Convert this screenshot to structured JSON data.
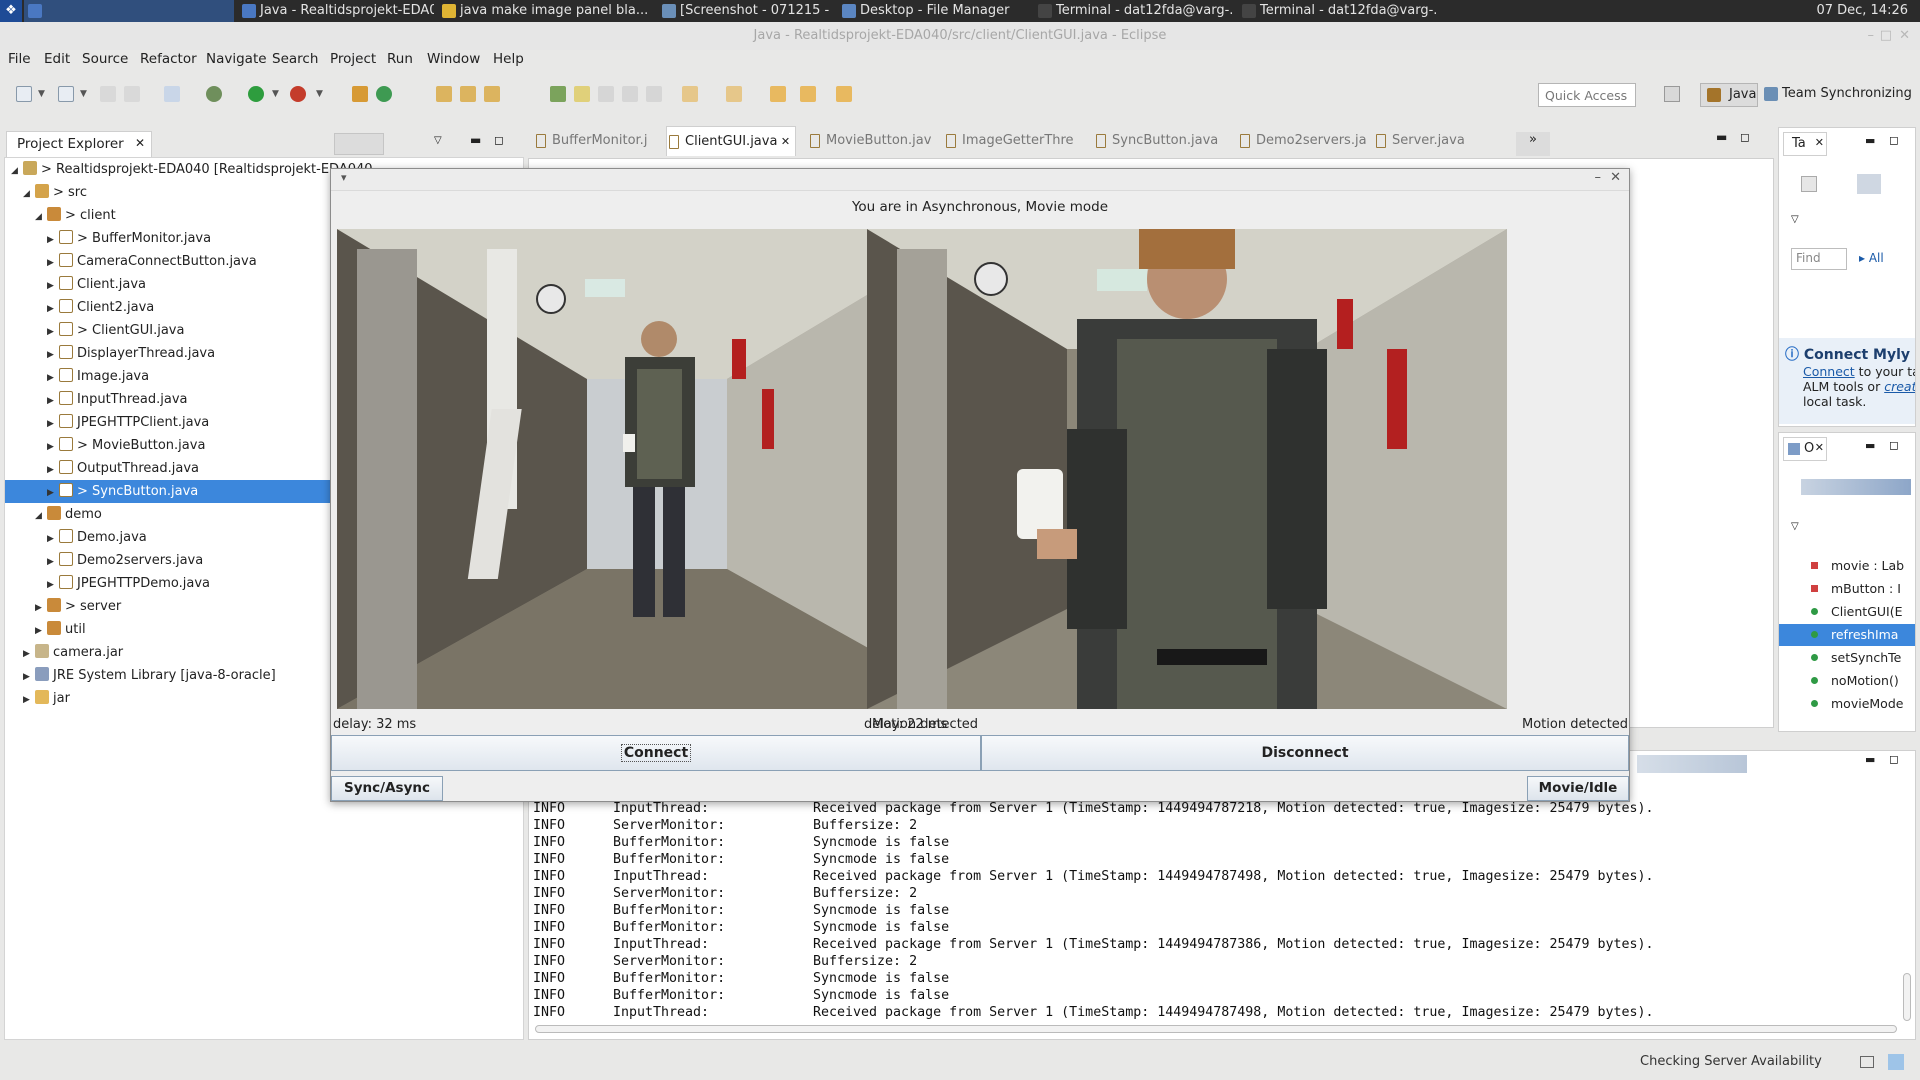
{
  "taskbar": {
    "tasks": [
      {
        "label": "",
        "active": true
      },
      {
        "label": "Java - Realtidsprojekt-EDA0..."
      },
      {
        "label": "java make image panel bla..."
      },
      {
        "label": "[Screenshot - 071215 - 13:1..."
      },
      {
        "label": "Desktop - File Manager"
      },
      {
        "label": "Terminal - dat12fda@varg-..."
      },
      {
        "label": "Terminal - dat12fda@varg-..."
      }
    ],
    "clock": "07 Dec, 14:26"
  },
  "window_title": "Java - Realtidsprojekt-EDA040/src/client/ClientGUI.java - Eclipse",
  "menu": [
    "File",
    "Edit",
    "Source",
    "Refactor",
    "Navigate",
    "Search",
    "Project",
    "Run",
    "Window",
    "Help"
  ],
  "quick_access": {
    "placeholder": "Quick Access"
  },
  "perspectives": {
    "java": "Java",
    "team": "Team Synchronizing"
  },
  "project_explorer": {
    "title": "Project Explorer",
    "tree": [
      {
        "label": "> Realtidsprojekt-EDA040  [Realtidsprojekt-EDA040",
        "depth": 0,
        "expanded": true,
        "icon": "project-icon"
      },
      {
        "label": "> src",
        "depth": 1,
        "expanded": true,
        "icon": "package-folder-icon"
      },
      {
        "label": "> client",
        "depth": 2,
        "expanded": true,
        "icon": "package-icon"
      },
      {
        "label": "> BufferMonitor.java",
        "depth": 3,
        "icon": "java-file-icon"
      },
      {
        "label": "CameraConnectButton.java",
        "depth": 3,
        "icon": "java-file-icon"
      },
      {
        "label": "Client.java",
        "depth": 3,
        "icon": "java-file-icon"
      },
      {
        "label": "Client2.java",
        "depth": 3,
        "icon": "java-file-icon"
      },
      {
        "label": "> ClientGUI.java",
        "depth": 3,
        "icon": "java-file-icon"
      },
      {
        "label": "DisplayerThread.java",
        "depth": 3,
        "icon": "java-file-icon"
      },
      {
        "label": "Image.java",
        "depth": 3,
        "icon": "java-file-icon"
      },
      {
        "label": "InputThread.java",
        "depth": 3,
        "icon": "java-file-icon"
      },
      {
        "label": "JPEGHTTPClient.java",
        "depth": 3,
        "icon": "java-file-icon"
      },
      {
        "label": "> MovieButton.java",
        "depth": 3,
        "icon": "java-file-icon"
      },
      {
        "label": "OutputThread.java",
        "depth": 3,
        "icon": "java-file-icon"
      },
      {
        "label": "> SyncButton.java",
        "depth": 3,
        "icon": "java-file-icon",
        "selected": true
      },
      {
        "label": "demo",
        "depth": 2,
        "expanded": true,
        "icon": "package-icon"
      },
      {
        "label": "Demo.java",
        "depth": 3,
        "icon": "java-file-icon"
      },
      {
        "label": "Demo2servers.java",
        "depth": 3,
        "icon": "java-file-icon"
      },
      {
        "label": "JPEGHTTPDemo.java",
        "depth": 3,
        "icon": "java-file-icon"
      },
      {
        "label": "> server",
        "depth": 2,
        "icon": "package-icon"
      },
      {
        "label": "util",
        "depth": 2,
        "icon": "package-icon"
      },
      {
        "label": "camera.jar",
        "depth": 1,
        "icon": "jar-icon"
      },
      {
        "label": "JRE System Library [java-8-oracle]",
        "depth": 1,
        "icon": "library-icon"
      },
      {
        "label": "jar",
        "depth": 1,
        "icon": "folder-icon"
      }
    ]
  },
  "editor_tabs": [
    {
      "label": "BufferMonitor.j"
    },
    {
      "label": "ClientGUI.java",
      "active": true
    },
    {
      "label": "MovieButton.jav"
    },
    {
      "label": "ImageGetterThre"
    },
    {
      "label": "SyncButton.java"
    },
    {
      "label": "Demo2servers.ja"
    },
    {
      "label": "Server.java"
    }
  ],
  "task_list": {
    "tab": "Ta",
    "find_placeholder": "Find",
    "all_label": "All",
    "connect_title": "Connect Myly",
    "connect_link": "Connect",
    "connect_text": "to your ta",
    "alm_text": "ALM tools or",
    "create_link": "creat",
    "local_task": "local task."
  },
  "outline": {
    "tab": "O",
    "items": [
      {
        "label": "movie : Lab",
        "kind": "field-private"
      },
      {
        "label": "mButton : I",
        "kind": "field-private"
      },
      {
        "label": "ClientGUI(E",
        "kind": "constructor"
      },
      {
        "label": "refreshIma",
        "kind": "method",
        "selected": true
      },
      {
        "label": "setSynchTe",
        "kind": "method"
      },
      {
        "label": "noMotion()",
        "kind": "method"
      },
      {
        "label": "movieMode",
        "kind": "method"
      }
    ]
  },
  "console": {
    "lines": [
      [
        "INFO",
        "InputThread:",
        "Received package from Server 1 (TimeStamp: 1449494787218, Motion detected: true, Imagesize: 25479 bytes)."
      ],
      [
        "INFO",
        "ServerMonitor:",
        "Buffersize: 2"
      ],
      [
        "INFO",
        "BufferMonitor:",
        "Syncmode is false"
      ],
      [
        "INFO",
        "BufferMonitor:",
        "Syncmode is false"
      ],
      [
        "INFO",
        "InputThread:",
        "Received package from Server 1 (TimeStamp: 1449494787498, Motion detected: true, Imagesize: 25479 bytes)."
      ],
      [
        "INFO",
        "ServerMonitor:",
        "Buffersize: 2"
      ],
      [
        "INFO",
        "BufferMonitor:",
        "Syncmode is false"
      ],
      [
        "INFO",
        "BufferMonitor:",
        "Syncmode is false"
      ],
      [
        "INFO",
        "InputThread:",
        "Received package from Server 1 (TimeStamp: 1449494787386, Motion detected: true, Imagesize: 25479 bytes)."
      ],
      [
        "INFO",
        "ServerMonitor:",
        "Buffersize: 2"
      ],
      [
        "INFO",
        "BufferMonitor:",
        "Syncmode is false"
      ],
      [
        "INFO",
        "BufferMonitor:",
        "Syncmode is false"
      ],
      [
        "INFO",
        "InputThread:",
        "Received package from Server 1 (TimeStamp: 1449494787498, Motion detected: true, Imagesize: 25479 bytes)."
      ]
    ]
  },
  "status": "Checking Server Availability",
  "client_window": {
    "mode": "You are in Asynchronous,    Movie mode",
    "cameras": [
      {
        "delay": "delay: 32 ms",
        "motion": "Motion detected"
      },
      {
        "delay": "delay: 22 ms",
        "motion": "Motion detected"
      }
    ],
    "connect": "Connect",
    "disconnect": "Disconnect",
    "sync_async": "Sync/Async",
    "movie_idle": "Movie/Idle"
  },
  "colors": {
    "selection": "#3c87dc",
    "java_badge": "#a4742a",
    "taskbar": "#2b2b2b"
  }
}
